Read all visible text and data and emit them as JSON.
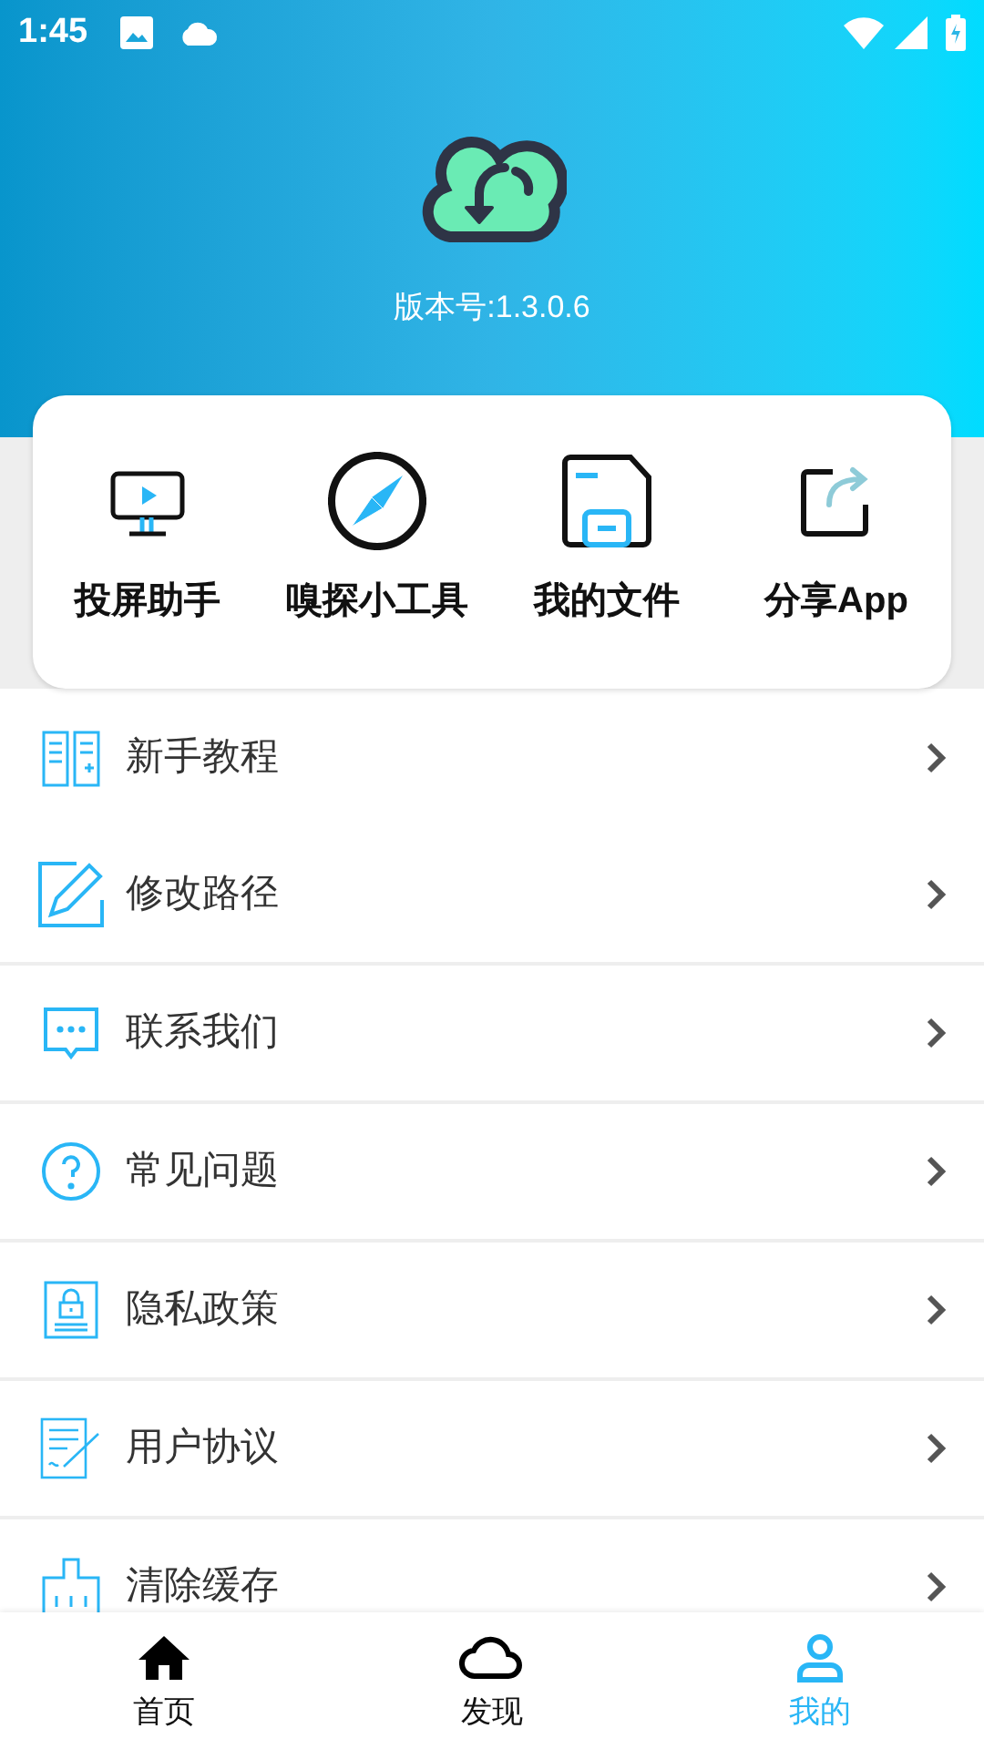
{
  "status_bar": {
    "time": "1:45"
  },
  "header": {
    "version": "版本号:1.3.0.6"
  },
  "quick_actions": [
    {
      "label": "投屏助手"
    },
    {
      "label": "嗅探小工具"
    },
    {
      "label": "我的文件"
    },
    {
      "label": "分享App"
    }
  ],
  "menu": [
    {
      "label": "新手教程"
    },
    {
      "label": "修改路径"
    },
    {
      "label": "联系我们"
    },
    {
      "label": "常见问题"
    },
    {
      "label": "隐私政策"
    },
    {
      "label": "用户协议"
    },
    {
      "label": "清除缓存"
    }
  ],
  "bottom_nav": [
    {
      "label": "首页",
      "selected": false
    },
    {
      "label": "发现",
      "selected": false
    },
    {
      "label": "我的",
      "selected": true
    }
  ]
}
